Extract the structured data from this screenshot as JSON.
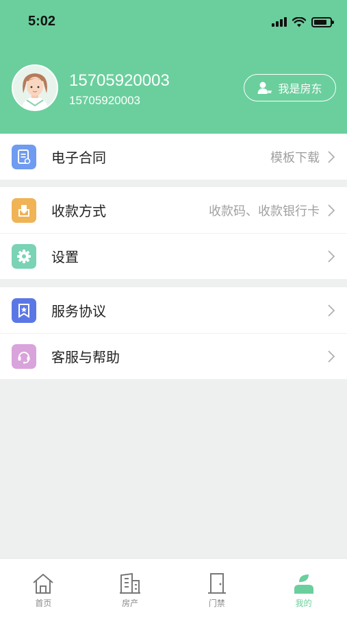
{
  "status_bar": {
    "time": "5:02"
  },
  "profile": {
    "name": "15705920003",
    "phone": "15705920003",
    "role_button_label": "我是房东"
  },
  "menu": {
    "contract": {
      "label": "电子合同",
      "hint": "模板下载"
    },
    "payment": {
      "label": "收款方式",
      "hint": "收款码、收款银行卡"
    },
    "settings": {
      "label": "设置"
    },
    "agreement": {
      "label": "服务协议"
    },
    "support": {
      "label": "客服与帮助"
    }
  },
  "tabbar": {
    "home": "首页",
    "property": "房产",
    "access": "门禁",
    "mine": "我的"
  },
  "colors": {
    "header_green": "#6acf9d",
    "contract_icon": "#6f9bf0",
    "payment_icon": "#f0b355",
    "settings_icon": "#79d3b4",
    "agreement_icon": "#5b77e6",
    "support_icon": "#d9a3dc"
  },
  "icons": {
    "contract": "document-icon",
    "payment": "download-box-icon",
    "settings": "gear-icon",
    "agreement": "bookmark-star-icon",
    "support": "headset-icon",
    "home_tab": "house-icon",
    "property_tab": "building-icon",
    "access_tab": "door-icon",
    "mine_tab": "person-icon"
  }
}
